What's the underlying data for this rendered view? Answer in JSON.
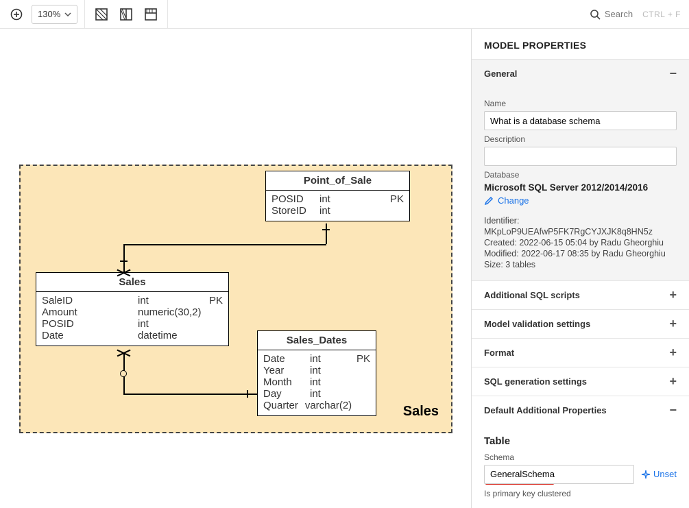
{
  "toolbar": {
    "zoom_label": "130%",
    "search_placeholder": "Search",
    "search_hint": "CTRL + F"
  },
  "canvas": {
    "schema_label": "Sales",
    "entities": {
      "point_of_sale": {
        "title": "Point_of_Sale",
        "cols": [
          {
            "name": "POSID",
            "type": "int",
            "flag": "PK"
          },
          {
            "name": "StoreID",
            "type": "int",
            "flag": ""
          }
        ]
      },
      "sales": {
        "title": "Sales",
        "cols": [
          {
            "name": "SaleID",
            "type": "int",
            "flag": "PK"
          },
          {
            "name": "Amount",
            "type": "numeric(30,2)",
            "flag": ""
          },
          {
            "name": "POSID",
            "type": "int",
            "flag": ""
          },
          {
            "name": "Date",
            "type": "datetime",
            "flag": ""
          }
        ]
      },
      "sales_dates": {
        "title": "Sales_Dates",
        "cols": [
          {
            "name": "Date",
            "type": "int",
            "flag": "PK"
          },
          {
            "name": "Year",
            "type": "int",
            "flag": ""
          },
          {
            "name": "Month",
            "type": "int",
            "flag": ""
          },
          {
            "name": "Day",
            "type": "int",
            "flag": ""
          },
          {
            "name": "Quarter",
            "type": "varchar(2)",
            "flag": ""
          }
        ]
      }
    }
  },
  "panel": {
    "title": "MODEL PROPERTIES",
    "general": {
      "label": "General",
      "name_label": "Name",
      "name_value": "What is a database schema",
      "desc_label": "Description",
      "desc_value": "",
      "db_label": "Database",
      "db_value": "Microsoft SQL Server 2012/2014/2016",
      "change_label": "Change",
      "identifier_label": "Identifier:",
      "identifier_value": "MKpLoP9UEAfwP5FK7RgCYJXJK8q8HN5z",
      "created_line": "Created: 2022-06-15 05:04 by Radu Gheorghiu",
      "modified_line": "Modified: 2022-06-17 08:35 by Radu Gheorghiu",
      "size_line": "Size: 3 tables"
    },
    "sections": {
      "addl_sql": "Additional SQL scripts",
      "validation": "Model validation settings",
      "format": "Format",
      "sqlgen": "SQL generation settings",
      "defaults": "Default Additional Properties"
    },
    "defaults": {
      "table_head": "Table",
      "schema_label": "Schema",
      "schema_value": "GeneralSchema",
      "unset_label": "Unset",
      "pk_clustered": "Is primary key clustered"
    }
  }
}
